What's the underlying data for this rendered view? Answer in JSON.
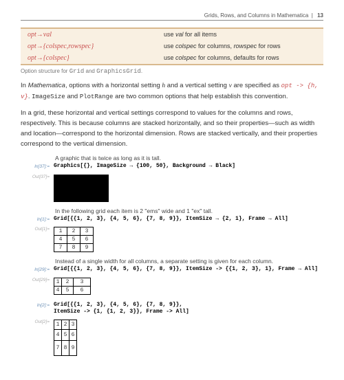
{
  "header": {
    "title": "Grids, Rows, and Columns in Mathematica",
    "page": "13"
  },
  "optTable": {
    "rows": [
      {
        "left": "opt→val",
        "right_pre": "use ",
        "right_em": "val",
        "right_post": " for all items"
      },
      {
        "left": "opt→{colspec,rowspec}",
        "right_pre": "use ",
        "right_em": "colspec",
        "right_mid": " for columns, ",
        "right_em2": "rowspec",
        "right_post": " for rows"
      },
      {
        "left": "opt→{colspec}",
        "right_pre": "use ",
        "right_em": "colspec",
        "right_post": " for columns, defaults for rows"
      }
    ]
  },
  "caption": "Option structure for Grid and GraphicsGrid.",
  "para1": {
    "a": "In ",
    "b": "Mathematica",
    "c": ", options with a horizontal setting ",
    "d": "h",
    "e": " and a vertical setting ",
    "f": "v",
    "g": " are specified as ",
    "h": "opt -> {h, v}",
    "i": ". ",
    "j": "ImageSize",
    "k": " and ",
    "l": "PlotRange",
    "m": " are two common options that help establish this convention."
  },
  "para2": "In a grid, these horizontal and vertical settings correspond to values for the columns and rows, respectively. This is because columns are stacked horizontally, and so their properties—such as width and location—correspond to the horizontal dimension. Rows are stacked vertically, and their properties correspond to the vertical dimension.",
  "ex1": {
    "desc": "A graphic that is twice as long as it is tall.",
    "inLabel": "In[37]:=",
    "inCode": "Graphics[{}, ImageSize → {100, 50}, Background → Black]",
    "outLabel": "Out[37]="
  },
  "ex2": {
    "desc": "In the following grid each item is 2 \"ems\" wide and 1 \"ex\" tall.",
    "inLabel": "In[1]:=",
    "inCode": "Grid[{{1, 2, 3}, {4, 5, 6}, {7, 8, 9}}, ItemSize → {2, 1}, Frame → All]",
    "outLabel": "Out[1]=",
    "grid": [
      [
        "1",
        "2",
        "3"
      ],
      [
        "4",
        "5",
        "6"
      ],
      [
        "7",
        "8",
        "9"
      ]
    ]
  },
  "ex3": {
    "desc": "Instead of a single width for all columns, a separate setting is given for each column.",
    "inLabel": "In[29]:=",
    "inCode": "Grid[{{1, 2, 3}, {4, 5, 6}, {7, 8, 9}}, ItemSize -> {{1, 2, 3}, 1}, Frame → All]",
    "outLabel": "Out[29]=",
    "grid": [
      [
        "1",
        "2",
        "3"
      ],
      [
        "4",
        "5",
        "6"
      ]
    ]
  },
  "ex4": {
    "inLabel": "In[2]:=",
    "inCode1": "Grid[{{1, 2, 3}, {4, 5, 6}, {7, 8, 9}},",
    "inCode2": " ItemSize -> {1, {1, 2, 3}}, Frame -> All]",
    "outLabel": "Out[2]=",
    "grid": [
      [
        "1",
        "2",
        "3"
      ],
      [
        "4",
        "5",
        "6"
      ],
      [
        "7",
        "8",
        "9"
      ]
    ]
  },
  "chart_data": [
    {
      "type": "table",
      "title": "Option structure for Grid and GraphicsGrid",
      "rows": [
        [
          "opt→val",
          "use val for all items"
        ],
        [
          "opt→{colspec,rowspec}",
          "use colspec for columns, rowspec for rows"
        ],
        [
          "opt→{colspec}",
          "use colspec for columns, defaults for rows"
        ]
      ]
    },
    {
      "type": "table",
      "title": "Grid ItemSize {2,1}",
      "rows": [
        [
          1,
          2,
          3
        ],
        [
          4,
          5,
          6
        ],
        [
          7,
          8,
          9
        ]
      ]
    },
    {
      "type": "table",
      "title": "Grid ItemSize {{1,2,3},1}",
      "rows": [
        [
          1,
          2,
          3
        ],
        [
          4,
          5,
          6
        ]
      ]
    },
    {
      "type": "table",
      "title": "Grid ItemSize {1,{1,2,3}}",
      "rows": [
        [
          1,
          2,
          3
        ],
        [
          4,
          5,
          6
        ],
        [
          7,
          8,
          9
        ]
      ]
    }
  ]
}
